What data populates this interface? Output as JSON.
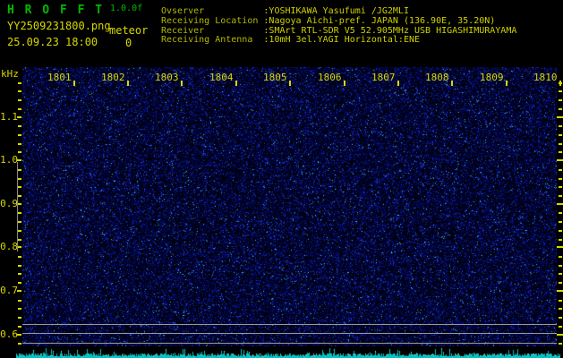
{
  "header": {
    "title": "H R O F F T",
    "version": "1.0.0f",
    "filename": "YY2509231800.png",
    "mode_label": "meteor",
    "meteor_count": "0",
    "datetime": "25.09.23 18:00",
    "info": [
      {
        "label": "Ovserver          ",
        "value": ":YOSHIKAWA Yasufumi /JG2MLI"
      },
      {
        "label": "Receiving Location",
        "value": ":Nagoya Aichi-pref. JAPAN (136.90E, 35.20N)"
      },
      {
        "label": "Receiver          ",
        "value": ":SMArt RTL-SDR V5 52.905MHz USB HIGASHIMURAYAMA"
      },
      {
        "label": "Receiving Antenna ",
        "value": ":10mH 3el.YAGI Horizontal:ENE"
      }
    ]
  },
  "chart_data": {
    "type": "heatmap",
    "description": "HROFFT radio meteor spectrogram: 10-minute waterfall of background noise, no meteor echoes visible; cyan strip at bottom is the received signal-level trace",
    "x_tick_labels": [
      "1801",
      "1802",
      "1803",
      "1804",
      "1805",
      "1806",
      "1807",
      "1808",
      "1809",
      "1810"
    ],
    "x_axis_note": "time labels, one per minute",
    "ylabel": "kHz",
    "y_tick_labels": [
      "1.1",
      "1.0",
      "0.9",
      "0.8",
      "0.7",
      "0.6"
    ],
    "y_major_khz": [
      1.1,
      1.0,
      0.9,
      0.8,
      0.7,
      0.6
    ],
    "y_minor_step_khz": 0.02,
    "y_range_khz": [
      0.58,
      1.18
    ],
    "reference_lines_khz": [
      0.624,
      0.603,
      0.58
    ],
    "meteor_count": 0,
    "legend": "none",
    "grid": "off"
  },
  "colors": {
    "background": "#000000",
    "title_green": "#00b800",
    "text_yellow": "#d8d800",
    "info_label_olive": "#b4b800",
    "info_value_yellow": "#d0d000",
    "noise_blue": "#0000c8",
    "trace_cyan": "#00c4c4",
    "reference_gray": "#9a9a9a"
  }
}
